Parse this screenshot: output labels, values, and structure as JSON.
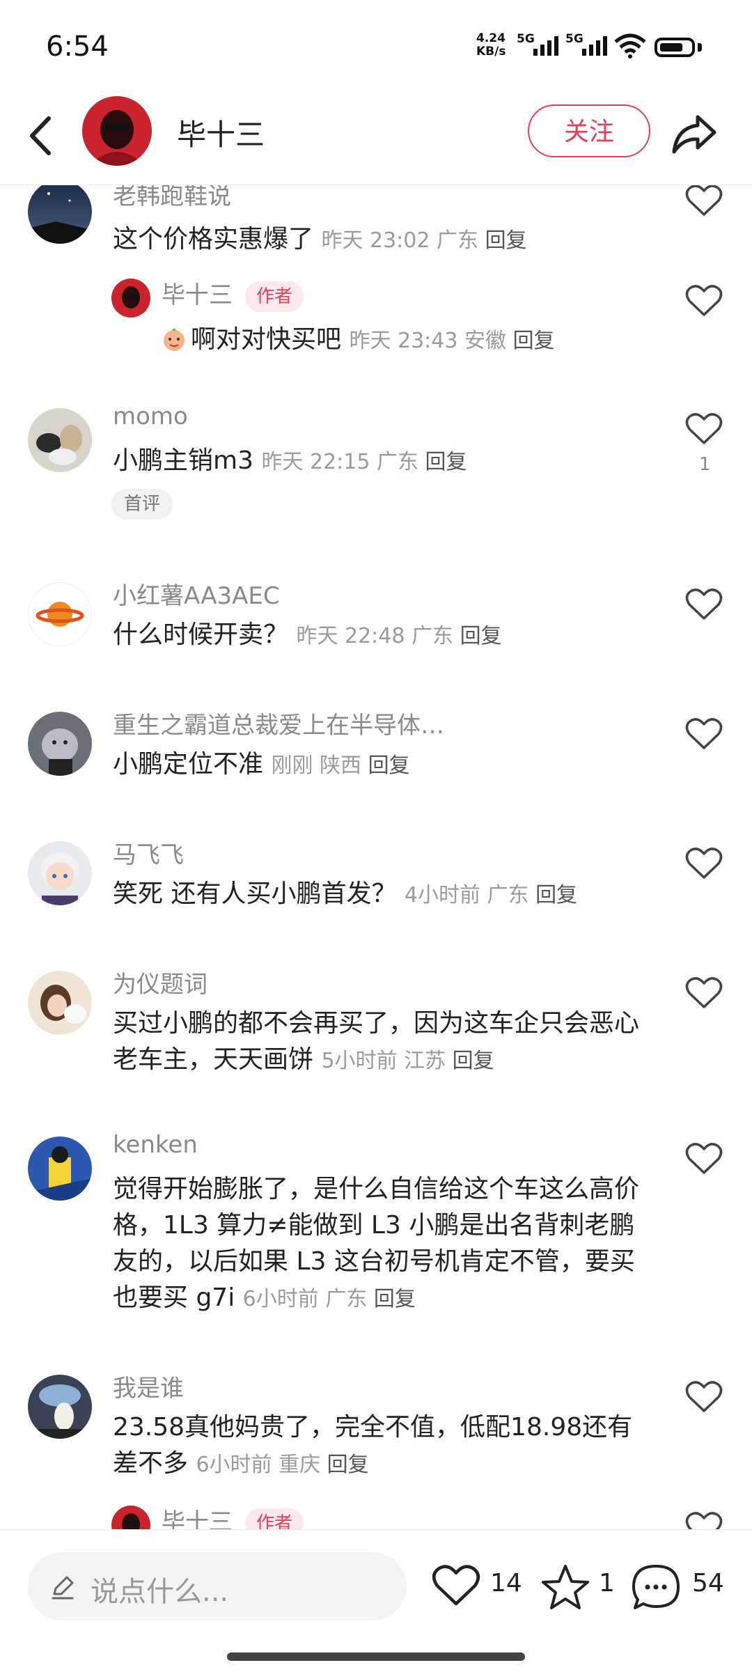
{
  "status_bar": {
    "time": "6:54",
    "net_speed_value": "4.24",
    "net_speed_unit": "KB/s",
    "signal1": "5G",
    "signal2": "5G"
  },
  "header": {
    "author": "毕十三",
    "follow_label": "关注"
  },
  "comments": [
    {
      "user": "老韩跑鞋说",
      "text": "这个价格实惠爆了",
      "time": "昨天 23:02",
      "location": "广东",
      "reply": "回复"
    },
    {
      "user": "毕十三",
      "tag": "作者",
      "text": "啊对对快买吧",
      "time": "昨天 23:43",
      "location": "安徽",
      "reply": "回复"
    },
    {
      "user": "momo",
      "text": "小鹏主销m3",
      "time": "昨天 22:15",
      "location": "广东",
      "reply": "回复",
      "likes": "1",
      "badge": "首评"
    },
    {
      "user": "小红薯AA3AEC",
      "text": "什么时候开卖？",
      "time": "昨天 22:48",
      "location": "广东",
      "reply": "回复"
    },
    {
      "user": "重生之霸道总裁爱上在半导体…",
      "text": "小鹏定位不准",
      "time": "刚刚",
      "location": "陕西",
      "reply": "回复"
    },
    {
      "user": "马飞飞",
      "text": "笑死 还有人买小鹏首发？",
      "time": "4小时前",
      "location": "广东",
      "reply": "回复"
    },
    {
      "user": "为仪题词",
      "text": "买过小鹏的都不会再买了，因为这车企只会恶心老车主，天天画饼",
      "time": "5小时前",
      "location": "江苏",
      "reply": "回复"
    },
    {
      "user": "kenken",
      "text": "觉得开始膨胀了，是什么自信给这个车这么高价格，1L3 算力≠能做到 L3  小鹏是出名背刺老鹏友的，以后如果 L3 这台初号机肯定不管，要买也要买 g7i",
      "time": "6小时前",
      "location": "广东",
      "reply": "回复"
    },
    {
      "user": "我是谁",
      "text": "23.58真他妈贵了，完全不值，低配18.98还有差不多",
      "time": "6小时前",
      "location": "重庆",
      "reply": "回复"
    },
    {
      "user": "毕十三",
      "tag": "作者"
    }
  ],
  "bottom_bar": {
    "input_placeholder": "说点什么...",
    "likes": "14",
    "stars": "1",
    "comments": "54"
  },
  "colors": {
    "accent": "#e0425a",
    "meta": "#9b9b9b"
  }
}
